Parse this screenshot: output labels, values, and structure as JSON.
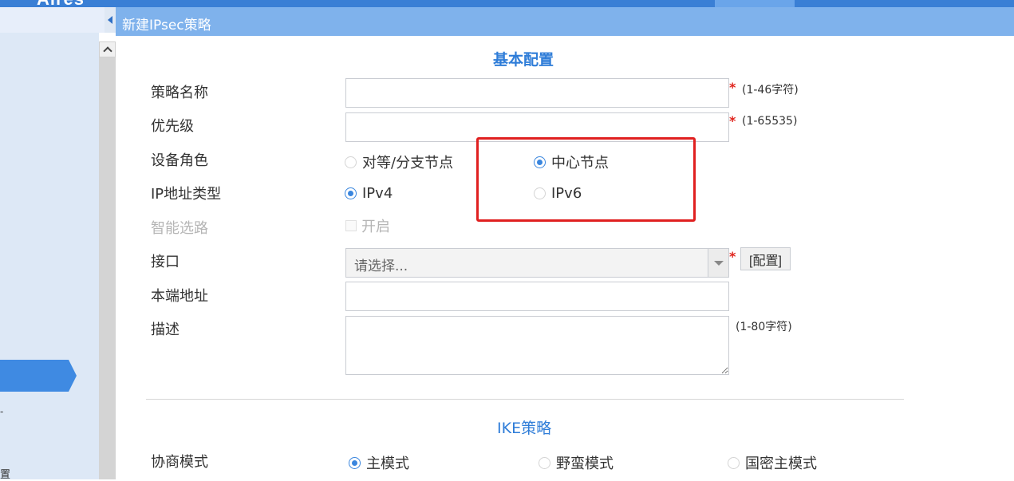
{
  "app": {
    "brand": "Aires"
  },
  "header": {
    "title": "新建IPsec策略"
  },
  "sidebar": {
    "fragment1": "-",
    "fragment2": "置"
  },
  "basic": {
    "section_title": "基本配置",
    "policy_name": {
      "label": "策略名称",
      "value": "",
      "required": "*",
      "hint": "(1-46字符)"
    },
    "priority": {
      "label": "优先级",
      "value": "",
      "required": "*",
      "hint": "(1-65535)"
    },
    "device_role": {
      "label": "设备角色",
      "options": [
        "对等/分支节点",
        "中心节点"
      ],
      "selected": "中心节点"
    },
    "ip_type": {
      "label": "IP地址类型",
      "options": [
        "IPv4",
        "IPv6"
      ],
      "selected": "IPv4"
    },
    "smart_route": {
      "label": "智能选路",
      "checkbox_label": "开启",
      "checked": false
    },
    "interface": {
      "label": "接口",
      "placeholder": "请选择...",
      "required": "*",
      "config_button": "[配置]"
    },
    "local_address": {
      "label": "本端地址",
      "value": ""
    },
    "description": {
      "label": "描述",
      "value": "",
      "hint": "(1-80字符)"
    }
  },
  "ike": {
    "section_title": "IKE策略",
    "negotiation_mode": {
      "label": "协商模式",
      "options": [
        "主模式",
        "野蛮模式",
        "国密主模式"
      ],
      "selected": "主模式"
    }
  },
  "colors": {
    "accent": "#3a86de",
    "header": "#7fb2ec",
    "highlight": "#e02020"
  }
}
